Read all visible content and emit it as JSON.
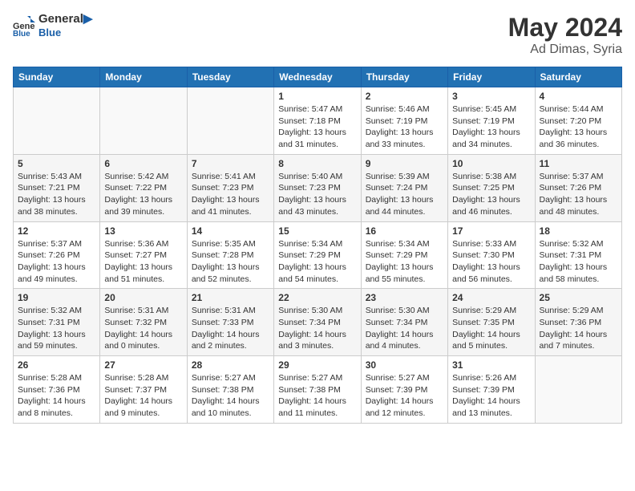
{
  "header": {
    "logo_line1": "General",
    "logo_line2": "Blue",
    "month_year": "May 2024",
    "location": "Ad Dimas, Syria"
  },
  "weekdays": [
    "Sunday",
    "Monday",
    "Tuesday",
    "Wednesday",
    "Thursday",
    "Friday",
    "Saturday"
  ],
  "weeks": [
    [
      {
        "day": "",
        "info": ""
      },
      {
        "day": "",
        "info": ""
      },
      {
        "day": "",
        "info": ""
      },
      {
        "day": "1",
        "info": "Sunrise: 5:47 AM\nSunset: 7:18 PM\nDaylight: 13 hours\nand 31 minutes."
      },
      {
        "day": "2",
        "info": "Sunrise: 5:46 AM\nSunset: 7:19 PM\nDaylight: 13 hours\nand 33 minutes."
      },
      {
        "day": "3",
        "info": "Sunrise: 5:45 AM\nSunset: 7:19 PM\nDaylight: 13 hours\nand 34 minutes."
      },
      {
        "day": "4",
        "info": "Sunrise: 5:44 AM\nSunset: 7:20 PM\nDaylight: 13 hours\nand 36 minutes."
      }
    ],
    [
      {
        "day": "5",
        "info": "Sunrise: 5:43 AM\nSunset: 7:21 PM\nDaylight: 13 hours\nand 38 minutes."
      },
      {
        "day": "6",
        "info": "Sunrise: 5:42 AM\nSunset: 7:22 PM\nDaylight: 13 hours\nand 39 minutes."
      },
      {
        "day": "7",
        "info": "Sunrise: 5:41 AM\nSunset: 7:23 PM\nDaylight: 13 hours\nand 41 minutes."
      },
      {
        "day": "8",
        "info": "Sunrise: 5:40 AM\nSunset: 7:23 PM\nDaylight: 13 hours\nand 43 minutes."
      },
      {
        "day": "9",
        "info": "Sunrise: 5:39 AM\nSunset: 7:24 PM\nDaylight: 13 hours\nand 44 minutes."
      },
      {
        "day": "10",
        "info": "Sunrise: 5:38 AM\nSunset: 7:25 PM\nDaylight: 13 hours\nand 46 minutes."
      },
      {
        "day": "11",
        "info": "Sunrise: 5:37 AM\nSunset: 7:26 PM\nDaylight: 13 hours\nand 48 minutes."
      }
    ],
    [
      {
        "day": "12",
        "info": "Sunrise: 5:37 AM\nSunset: 7:26 PM\nDaylight: 13 hours\nand 49 minutes."
      },
      {
        "day": "13",
        "info": "Sunrise: 5:36 AM\nSunset: 7:27 PM\nDaylight: 13 hours\nand 51 minutes."
      },
      {
        "day": "14",
        "info": "Sunrise: 5:35 AM\nSunset: 7:28 PM\nDaylight: 13 hours\nand 52 minutes."
      },
      {
        "day": "15",
        "info": "Sunrise: 5:34 AM\nSunset: 7:29 PM\nDaylight: 13 hours\nand 54 minutes."
      },
      {
        "day": "16",
        "info": "Sunrise: 5:34 AM\nSunset: 7:29 PM\nDaylight: 13 hours\nand 55 minutes."
      },
      {
        "day": "17",
        "info": "Sunrise: 5:33 AM\nSunset: 7:30 PM\nDaylight: 13 hours\nand 56 minutes."
      },
      {
        "day": "18",
        "info": "Sunrise: 5:32 AM\nSunset: 7:31 PM\nDaylight: 13 hours\nand 58 minutes."
      }
    ],
    [
      {
        "day": "19",
        "info": "Sunrise: 5:32 AM\nSunset: 7:31 PM\nDaylight: 13 hours\nand 59 minutes."
      },
      {
        "day": "20",
        "info": "Sunrise: 5:31 AM\nSunset: 7:32 PM\nDaylight: 14 hours\nand 0 minutes."
      },
      {
        "day": "21",
        "info": "Sunrise: 5:31 AM\nSunset: 7:33 PM\nDaylight: 14 hours\nand 2 minutes."
      },
      {
        "day": "22",
        "info": "Sunrise: 5:30 AM\nSunset: 7:34 PM\nDaylight: 14 hours\nand 3 minutes."
      },
      {
        "day": "23",
        "info": "Sunrise: 5:30 AM\nSunset: 7:34 PM\nDaylight: 14 hours\nand 4 minutes."
      },
      {
        "day": "24",
        "info": "Sunrise: 5:29 AM\nSunset: 7:35 PM\nDaylight: 14 hours\nand 5 minutes."
      },
      {
        "day": "25",
        "info": "Sunrise: 5:29 AM\nSunset: 7:36 PM\nDaylight: 14 hours\nand 7 minutes."
      }
    ],
    [
      {
        "day": "26",
        "info": "Sunrise: 5:28 AM\nSunset: 7:36 PM\nDaylight: 14 hours\nand 8 minutes."
      },
      {
        "day": "27",
        "info": "Sunrise: 5:28 AM\nSunset: 7:37 PM\nDaylight: 14 hours\nand 9 minutes."
      },
      {
        "day": "28",
        "info": "Sunrise: 5:27 AM\nSunset: 7:38 PM\nDaylight: 14 hours\nand 10 minutes."
      },
      {
        "day": "29",
        "info": "Sunrise: 5:27 AM\nSunset: 7:38 PM\nDaylight: 14 hours\nand 11 minutes."
      },
      {
        "day": "30",
        "info": "Sunrise: 5:27 AM\nSunset: 7:39 PM\nDaylight: 14 hours\nand 12 minutes."
      },
      {
        "day": "31",
        "info": "Sunrise: 5:26 AM\nSunset: 7:39 PM\nDaylight: 14 hours\nand 13 minutes."
      },
      {
        "day": "",
        "info": ""
      }
    ]
  ]
}
